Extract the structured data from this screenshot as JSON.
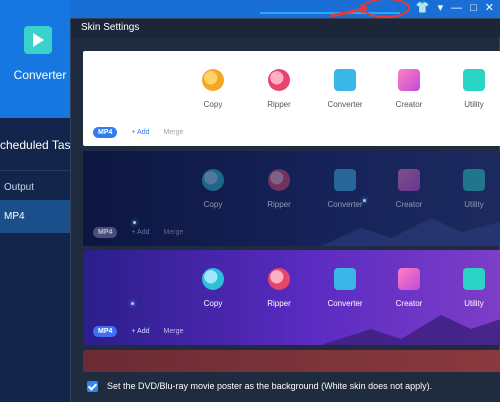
{
  "background_app": {
    "converter_tile_label": "Converter",
    "scheduled_task_label": "cheduled Task",
    "output_label": "Output",
    "selected_format_label": "MP4"
  },
  "window_controls": {
    "skin_icon": "tshirt-icon",
    "dropdown_glyph": "▾",
    "minimize_glyph": "—",
    "maximize_glyph": "□",
    "close_glyph": "✕"
  },
  "dialog": {
    "title": "Skin Settings",
    "skins": [
      {
        "name": "white",
        "modules": [
          "Copy",
          "Ripper",
          "Converter",
          "Creator",
          "Utility"
        ],
        "format_pill": "MP4",
        "add_label": "+ Add",
        "merge_label": "Merge"
      },
      {
        "name": "dark",
        "modules": [
          "Copy",
          "Ripper",
          "Converter",
          "Creator",
          "Utility"
        ],
        "format_pill": "MP4",
        "add_label": "+ Add",
        "merge_label": "Merge"
      },
      {
        "name": "purple",
        "modules": [
          "Copy",
          "Ripper",
          "Converter",
          "Creator",
          "Utility"
        ],
        "format_pill": "MP4",
        "add_label": "+ Add",
        "merge_label": "Merge"
      }
    ],
    "footer": {
      "checkbox_checked": true,
      "checkbox_label": "Set the DVD/Blu-ray movie poster as the background (White skin does not apply)."
    }
  }
}
